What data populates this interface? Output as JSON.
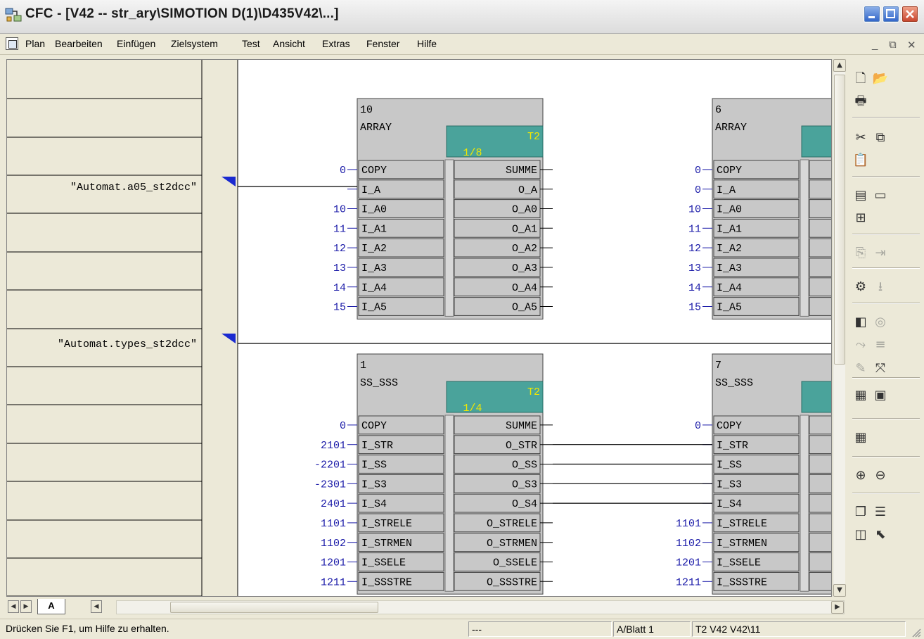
{
  "window": {
    "title": "CFC - [V42 -- str_ary\\SIMOTION D(1)\\D435V42\\...]"
  },
  "menu": {
    "items": [
      "Plan",
      "Bearbeiten",
      "Einfügen",
      "Zielsystem",
      "Test",
      "Ansicht",
      "Extras",
      "Fenster",
      "Hilfe"
    ],
    "mdi_minimize": "_",
    "mdi_restore": "⧉",
    "mdi_close": "✕"
  },
  "sheet": {
    "margin_labels": [
      "\"Automat.a05_st2dcc\"",
      "\"Automat.types_st2dcc\""
    ],
    "blocks": [
      {
        "number": "10",
        "type": "ARRAY",
        "task": "T2",
        "sequence": "1/8",
        "inputs": [
          {
            "pin": "COPY",
            "value": "0"
          },
          {
            "pin": "I_A",
            "value": ""
          },
          {
            "pin": "I_A0",
            "value": "10"
          },
          {
            "pin": "I_A1",
            "value": "11"
          },
          {
            "pin": "I_A2",
            "value": "12"
          },
          {
            "pin": "I_A3",
            "value": "13"
          },
          {
            "pin": "I_A4",
            "value": "14"
          },
          {
            "pin": "I_A5",
            "value": "15"
          }
        ],
        "outputs": [
          "SUMME",
          "O_A",
          "O_A0",
          "O_A1",
          "O_A2",
          "O_A3",
          "O_A4",
          "O_A5"
        ]
      },
      {
        "number": "6",
        "type": "ARRAY",
        "task": "",
        "sequence": "",
        "inputs": [
          {
            "pin": "COPY",
            "value": "0"
          },
          {
            "pin": "I_A",
            "value": "0"
          },
          {
            "pin": "I_A0",
            "value": "10"
          },
          {
            "pin": "I_A1",
            "value": "11"
          },
          {
            "pin": "I_A2",
            "value": "12"
          },
          {
            "pin": "I_A3",
            "value": "13"
          },
          {
            "pin": "I_A4",
            "value": "14"
          },
          {
            "pin": "I_A5",
            "value": "15"
          }
        ],
        "outputs": []
      },
      {
        "number": "1",
        "type": "SS_SSS",
        "task": "T2",
        "sequence": "1/4",
        "inputs": [
          {
            "pin": "COPY",
            "value": "0"
          },
          {
            "pin": "I_STR",
            "value": "2101"
          },
          {
            "pin": "I_SS",
            "value": "-2201"
          },
          {
            "pin": "I_S3",
            "value": "-2301"
          },
          {
            "pin": "I_S4",
            "value": "2401"
          },
          {
            "pin": "I_STRELE",
            "value": "1101"
          },
          {
            "pin": "I_STRMEN",
            "value": "1102"
          },
          {
            "pin": "I_SSELE",
            "value": "1201"
          },
          {
            "pin": "I_SSSTRE",
            "value": "1211"
          }
        ],
        "outputs": [
          "SUMME",
          "O_STR",
          "O_SS",
          "O_S3",
          "O_S4",
          "O_STRELE",
          "O_STRMEN",
          "O_SSELE",
          "O_SSSTRE"
        ]
      },
      {
        "number": "7",
        "type": "SS_SSS",
        "task": "",
        "sequence": "",
        "inputs": [
          {
            "pin": "COPY",
            "value": "0"
          },
          {
            "pin": "I_STR",
            "value": ""
          },
          {
            "pin": "I_SS",
            "value": ""
          },
          {
            "pin": "I_S3",
            "value": ""
          },
          {
            "pin": "I_S4",
            "value": ""
          },
          {
            "pin": "I_STRELE",
            "value": "1101"
          },
          {
            "pin": "I_STRMEN",
            "value": "1102"
          },
          {
            "pin": "I_SSELE",
            "value": "1201"
          },
          {
            "pin": "I_SSSTRE",
            "value": "1211"
          }
        ],
        "outputs": []
      }
    ]
  },
  "tabs": {
    "sheet_tab": "A"
  },
  "status": {
    "help": "Drücken Sie F1, um Hilfe zu erhalten.",
    "mode": "---",
    "sheet": "A/Blatt 1",
    "path": "T2 V42 V42\\11"
  },
  "colors": {
    "block_fill": "#c8c8c8",
    "task_box": "#4aa39b",
    "sequence_text": "#f2e800",
    "value_text": "#1a1aa8",
    "margin_marker": "#1a2ad0"
  },
  "toolbar_icons": [
    "new-file-icon",
    "open-folder-icon",
    "print-icon",
    "cut-icon",
    "copy-icon",
    "paste-icon",
    "catalog-icon",
    "window-icon",
    "tree-icon",
    "disabled-compile-icon",
    "disabled-arrow-icon",
    "compile-icon",
    "download-icon",
    "test-mode-icon",
    "watch-icon",
    "disabled-link-icon",
    "disabled-line-icon",
    "disabled-edit-icon",
    "overview-icon",
    "grid-icon",
    "sheet-view-icon",
    "sheet-menu-icon",
    "zoom-in-icon",
    "zoom-out-icon",
    "cascade-icon",
    "tile-horizontal-icon",
    "tile-vertical-icon",
    "help-pointer-icon"
  ]
}
